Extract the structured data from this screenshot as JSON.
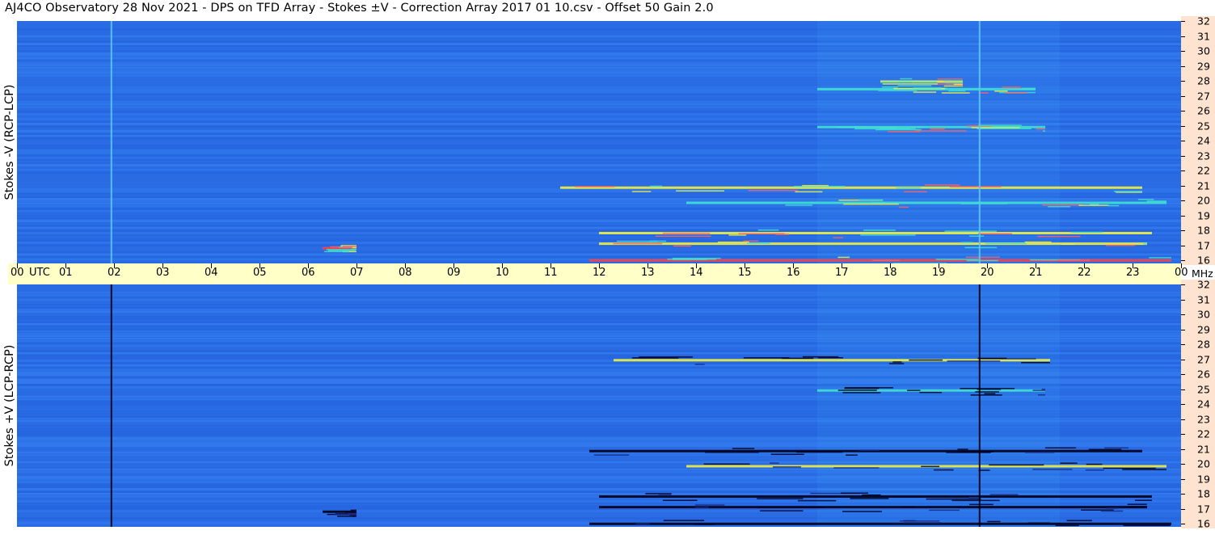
{
  "title": "AJ4CO Observatory  28 Nov 2021  -  DPS on TFD Array  -  Stokes ±V  -  Correction Array 2017 01 10.csv  -  Offset 50  Gain 2.0",
  "chart_data": [
    {
      "type": "heatmap",
      "panel": "top",
      "ylabel": "Stokes -V (RCP-LCP)",
      "y_unit": "MHz",
      "y_range": [
        16,
        32
      ],
      "y_ticks": [
        "32",
        "31",
        "30",
        "29",
        "28",
        "27",
        "26",
        "25",
        "24",
        "23",
        "22",
        "21",
        "20",
        "19",
        "18",
        "17",
        "16"
      ],
      "x_range_utc_hours": [
        0,
        24
      ],
      "colormap": [
        "#000018",
        "#1a3fd8",
        "#2a6fe8",
        "#3aa0f0",
        "#40e0d0",
        "#f0f040",
        "#ff4040"
      ],
      "emission_bursts": [
        {
          "utc_start": 11.2,
          "utc_end": 23.2,
          "mhz": 21.0,
          "color": "#f0f040"
        },
        {
          "utc_start": 12.0,
          "utc_end": 23.4,
          "mhz": 18.0,
          "color": "#f0f040"
        },
        {
          "utc_start": 12.0,
          "utc_end": 23.3,
          "mhz": 17.3,
          "color": "#f0f040"
        },
        {
          "utc_start": 11.8,
          "utc_end": 23.8,
          "mhz": 16.2,
          "color": "#ff4040"
        },
        {
          "utc_start": 13.8,
          "utc_end": 23.7,
          "mhz": 20.0,
          "color": "#40e0d0"
        },
        {
          "utc_start": 16.5,
          "utc_end": 21.0,
          "mhz": 27.5,
          "color": "#40e0d0"
        },
        {
          "utc_start": 16.5,
          "utc_end": 21.2,
          "mhz": 25.0,
          "color": "#40e0d0"
        },
        {
          "utc_start": 17.8,
          "utc_end": 19.5,
          "mhz": 28.0,
          "color": "#f0f040"
        },
        {
          "utc_start": 6.3,
          "utc_end": 7.0,
          "mhz": 17.0,
          "color": "#ff4040"
        }
      ],
      "vertical_markers_utc": [
        1.93,
        19.83
      ]
    },
    {
      "type": "heatmap",
      "panel": "bottom",
      "ylabel": "Stokes +V (LCP-RCP)",
      "y_unit": "MHz",
      "y_range": [
        16,
        32
      ],
      "y_ticks": [
        "32",
        "31",
        "30",
        "29",
        "28",
        "27",
        "26",
        "25",
        "24",
        "23",
        "22",
        "21",
        "20",
        "19",
        "18",
        "17",
        "16"
      ],
      "x_range_utc_hours": [
        0,
        24
      ],
      "emission_bursts": [
        {
          "utc_start": 11.8,
          "utc_end": 23.2,
          "mhz": 21.0,
          "color": "#000018"
        },
        {
          "utc_start": 12.0,
          "utc_end": 23.4,
          "mhz": 18.0,
          "color": "#000018"
        },
        {
          "utc_start": 12.0,
          "utc_end": 23.3,
          "mhz": 17.3,
          "color": "#000018"
        },
        {
          "utc_start": 11.8,
          "utc_end": 23.8,
          "mhz": 16.2,
          "color": "#000018"
        },
        {
          "utc_start": 13.8,
          "utc_end": 23.7,
          "mhz": 20.0,
          "color": "#f0f040"
        },
        {
          "utc_start": 12.3,
          "utc_end": 21.3,
          "mhz": 27.0,
          "color": "#f0f040"
        },
        {
          "utc_start": 16.5,
          "utc_end": 21.2,
          "mhz": 25.0,
          "color": "#40e0d0"
        },
        {
          "utc_start": 6.3,
          "utc_end": 7.0,
          "mhz": 17.0,
          "color": "#000018"
        }
      ],
      "vertical_markers_utc": [
        1.93,
        19.83
      ]
    }
  ],
  "time_axis": {
    "labels": [
      "00",
      "UTC",
      "01",
      "02",
      "03",
      "04",
      "05",
      "06",
      "07",
      "08",
      "09",
      "10",
      "11",
      "12",
      "13",
      "14",
      "15",
      "16",
      "17",
      "18",
      "19",
      "20",
      "21",
      "22",
      "23",
      "00"
    ],
    "unit_label": "MHz"
  }
}
